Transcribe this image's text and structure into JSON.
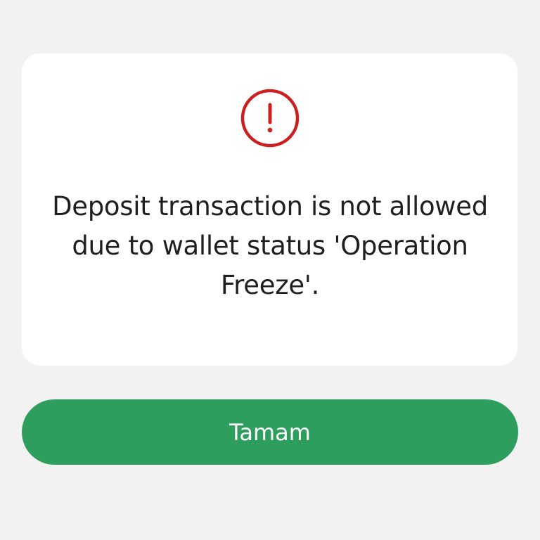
{
  "dialog": {
    "icon": "exclamation-circle-icon",
    "icon_color": "#cc1f1f",
    "message": "Deposit transaction is not allowed due to wallet status 'Operation Freeze'.",
    "button_label": "Tamam",
    "button_color": "#2e9e5f"
  }
}
